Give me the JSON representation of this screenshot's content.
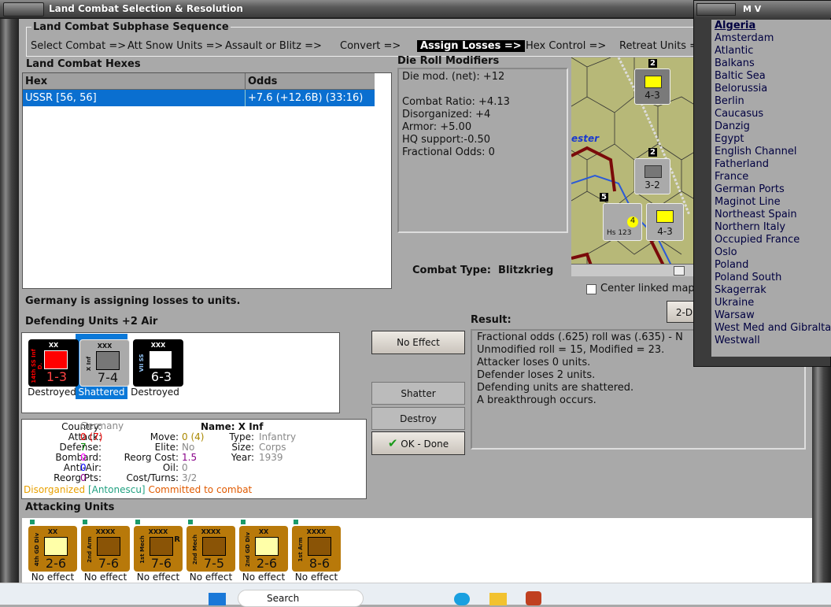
{
  "window": {
    "title": "Land Combat Selection & Resolution"
  },
  "subphase": {
    "title": "Land Combat Subphase Sequence",
    "steps": [
      "Select Combat =>",
      "Att Snow Units =>",
      "Assault or Blitz =>",
      "Convert =>",
      "Assign Losses =>",
      "Hex Control =>",
      "Retreat Units ="
    ],
    "active_index": 4
  },
  "hexes": {
    "title": "Land Combat Hexes",
    "columns": [
      "Hex",
      "Odds"
    ],
    "rows": [
      {
        "hex": "USSR [56, 56]",
        "odds": "+7.6 (+12.6B) (33:16)"
      }
    ]
  },
  "modifiers": {
    "title": "Die Roll Modifiers",
    "lines": [
      "Die mod. (net): +12",
      "",
      "Combat Ratio: +4.13",
      "Disorganized: +4",
      "Armor: +5.00",
      "HQ support:-0.50",
      "Fractional Odds: 0"
    ]
  },
  "combat_type": {
    "label": "Combat Type:",
    "value": "Blitzkrieg"
  },
  "center_map": {
    "label": "Center linked map",
    "checked": false
  },
  "status": "Germany is assigning losses to units.",
  "two_d_button": "2-D",
  "defenders": {
    "title": "Defending Units +2 Air",
    "units": [
      {
        "name": "14th SS Inf D.",
        "size": "XX",
        "value": "1-3",
        "status": "Destroyed"
      },
      {
        "name": "X Inf",
        "size": "XXX",
        "value": "7-4",
        "status": "Shattered",
        "selected": true
      },
      {
        "name": "VII SS",
        "size": "XXX",
        "value": "6-3",
        "status": "Destroyed"
      }
    ]
  },
  "info": {
    "country_l": "Country:",
    "country": "Germany",
    "attack_l": "Attack:",
    "attack": "0",
    "attack2": "(7)",
    "defense_l": "Defense:",
    "defense": "7",
    "bombard_l": "Bombard:",
    "bombard": "0",
    "antiair_l": "Anti-Air:",
    "antiair": "0",
    "reorgpts_l": "Reorg Pts:",
    "reorgpts": "0",
    "name_l": "Name: X Inf",
    "move_l": "Move:",
    "move": "0 (4)",
    "elite_l": "Elite:",
    "elite": "No",
    "reorgcost_l": "Reorg Cost:",
    "reorgcost": "1.5",
    "oil_l": "Oil:",
    "oil": "0",
    "cost_l": "Cost/Turns:",
    "cost": "3/2",
    "type_l": "Type:",
    "type": "Infantry",
    "size_l": "Size:",
    "size": "Corps",
    "year_l": "Year:",
    "year": "1939",
    "disorg": "Disorganized",
    "leader": "[Antonescu]",
    "committed": "Committed to combat"
  },
  "buttons": {
    "no_effect": "No Effect",
    "shatter": "Shatter",
    "destroy": "Destroy",
    "ok": "OK - Done"
  },
  "result": {
    "title": "Result:",
    "lines": [
      "Fractional odds (.625) roll was (.635)  - N",
      "Unmodified roll = 15, Modified = 23.",
      "Attacker loses 0 units.",
      "Defender loses 2 units.",
      "Defending units are shattered.",
      "A breakthrough occurs."
    ]
  },
  "attackers": {
    "title": "Attacking Units",
    "units": [
      {
        "name": "4th GD Div",
        "size": "XX",
        "value": "2-6",
        "status": "No effect",
        "light": true
      },
      {
        "name": "2nd Arm",
        "size": "XXXX",
        "value": "7-6",
        "status": "No effect"
      },
      {
        "name": "1st Mech",
        "size": "XXXX",
        "value": "7-6",
        "status": "No effect",
        "badge": "R"
      },
      {
        "name": "2nd Mech",
        "size": "XXXX",
        "value": "7-5",
        "status": "No effect"
      },
      {
        "name": "2nd GD Div",
        "size": "XX",
        "value": "2-6",
        "status": "No effect",
        "light": true
      },
      {
        "name": "1st Arm",
        "size": "XXXX",
        "value": "8-6",
        "status": "No effect"
      }
    ]
  },
  "map": {
    "river_label": "ester",
    "stacks": [
      "2",
      "2",
      "5"
    ],
    "counters": [
      "4-3",
      "3-2",
      "4-3",
      "2"
    ],
    "air_value": "4",
    "air_name": "Hs 123"
  },
  "mv": {
    "title": "M V",
    "items": [
      "Algeria",
      "Amsterdam",
      "Atlantic",
      "Balkans",
      "Baltic Sea",
      "Belorussia",
      "Berlin",
      "Caucasus",
      "Danzig",
      "Egypt",
      "English Channel",
      "Fatherland",
      "France",
      "German Ports",
      "Maginot Line",
      "Northeast Spain",
      "Northern Italy",
      "Occupied France",
      "Oslo",
      "Poland",
      "Poland South",
      "Skagerrak",
      "Ukraine",
      "Warsaw",
      "West Med and Gibraltar",
      "Westwall"
    ]
  },
  "taskbar": {
    "search": "Search"
  }
}
